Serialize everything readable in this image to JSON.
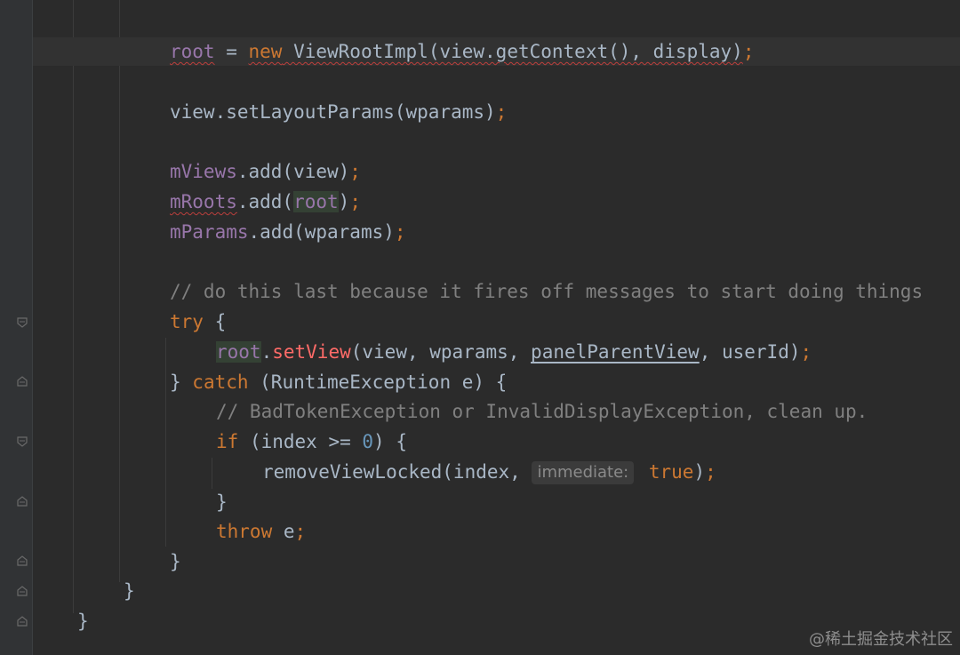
{
  "editor": {
    "lines": [
      {
        "id": "assign-root",
        "tokens": {
          "a": "root",
          "b": " = ",
          "c": "new",
          "d": " ViewRootImpl(view.getContext(), display)",
          "e": ";"
        }
      },
      {
        "id": "set-layout",
        "tokens": {
          "a": "view.setLayoutParams(wparams)",
          "b": ";"
        }
      },
      {
        "id": "mviews-add",
        "tokens": {
          "a": "mViews",
          "b": ".add(view)",
          "c": ";"
        }
      },
      {
        "id": "mroots-add",
        "tokens": {
          "a": "mRoots",
          "b": ".add(",
          "c": "root",
          "d": ")",
          "e": ";"
        }
      },
      {
        "id": "mparams-add",
        "tokens": {
          "a": "mParams",
          "b": ".add(wparams)",
          "c": ";"
        }
      },
      {
        "id": "comment-last",
        "tokens": {
          "a": "// do this last because it fires off messages to start doing things"
        }
      },
      {
        "id": "try-open",
        "tokens": {
          "a": "try",
          "b": " {"
        }
      },
      {
        "id": "set-view",
        "tokens": {
          "a": "root",
          "b": ".",
          "c": "setView",
          "d": "(view, wparams, ",
          "e": "panelParentView",
          "f": ", userId)",
          "g": ";"
        }
      },
      {
        "id": "catch-open",
        "tokens": {
          "a": "} ",
          "b": "catch",
          "c": " (RuntimeException e) {"
        }
      },
      {
        "id": "comment-bad",
        "tokens": {
          "a": "// BadTokenException or InvalidDisplayException, clean up."
        }
      },
      {
        "id": "if-open",
        "tokens": {
          "a": "if",
          "b": " (index >= ",
          "c": "0",
          "d": ") {"
        }
      },
      {
        "id": "remove-view",
        "tokens": {
          "a": "removeViewLocked(index, ",
          "hint": "immediate:",
          "b": " true",
          "c": ")",
          "d": ";"
        }
      },
      {
        "id": "if-close",
        "tokens": {
          "a": "}"
        }
      },
      {
        "id": "throw",
        "tokens": {
          "a": "throw",
          "b": " e",
          "c": ";"
        }
      },
      {
        "id": "catch-close",
        "tokens": {
          "a": "}"
        }
      },
      {
        "id": "block-close",
        "tokens": {
          "a": "}"
        }
      },
      {
        "id": "method-close",
        "tokens": {
          "a": "}"
        }
      }
    ]
  },
  "watermark": "@稀土掘金技术社区",
  "colors": {
    "background": "#2b2b2b",
    "keyword": "#cc7832",
    "field": "#9876aa",
    "number": "#6897bb",
    "comment": "#808080",
    "text": "#a9b7c6"
  }
}
